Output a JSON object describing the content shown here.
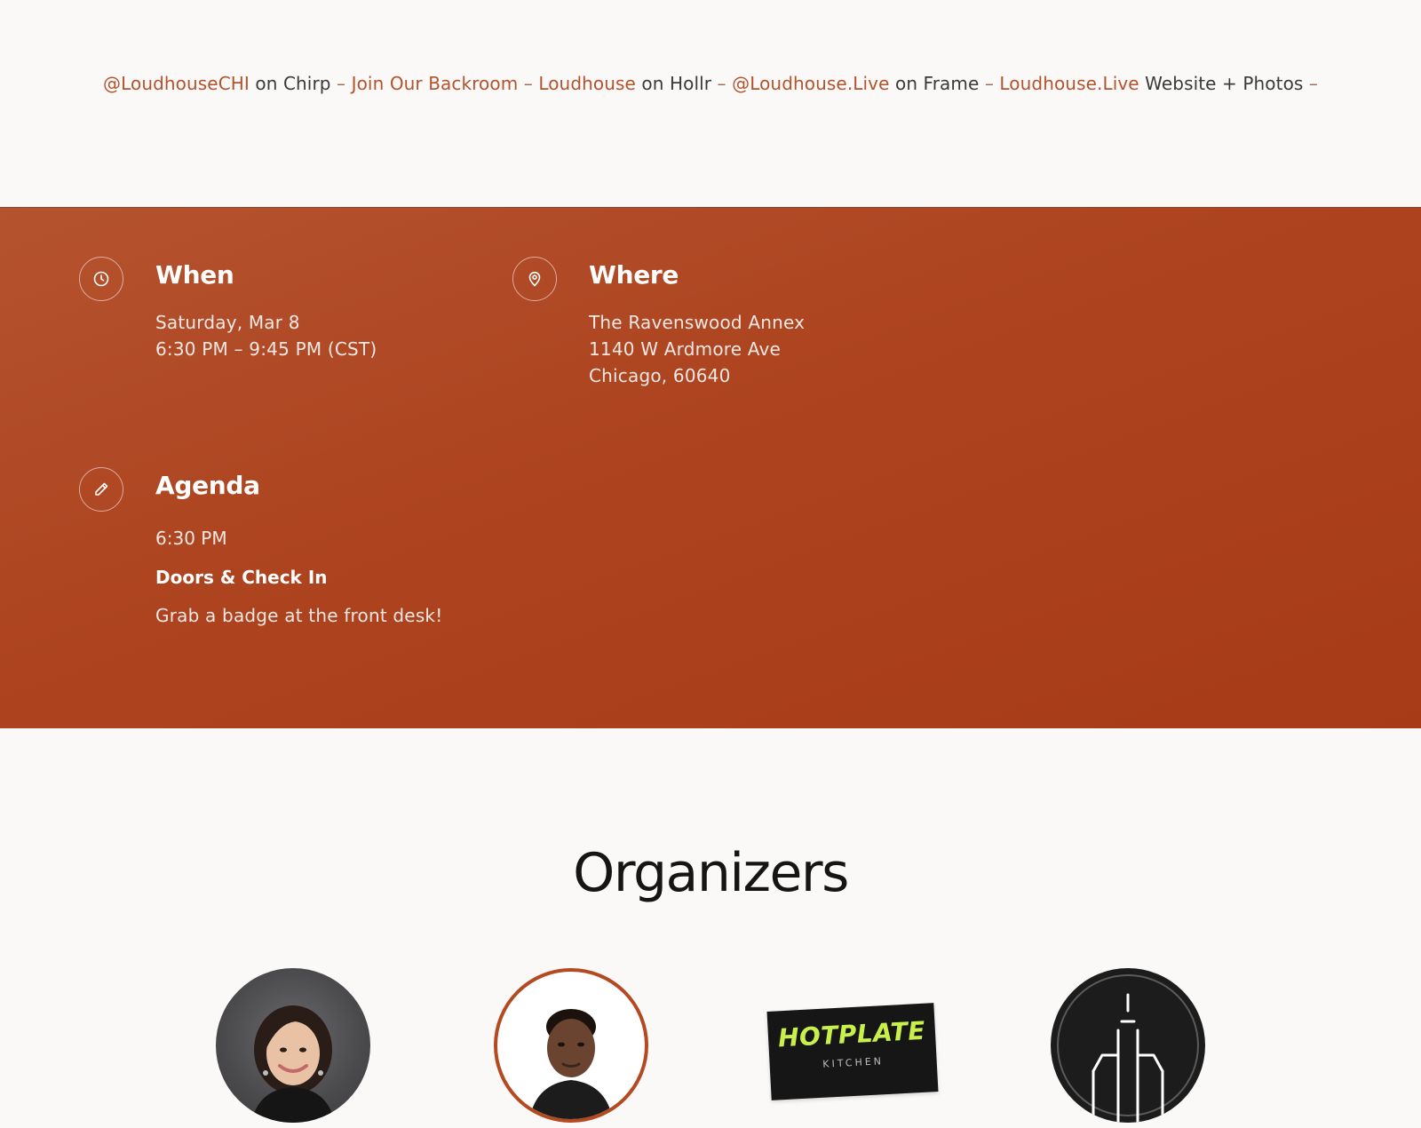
{
  "links": {
    "items": [
      {
        "link": "@LoudhouseCHI",
        "suffix": " on Chirp"
      },
      {
        "link": "Join Our Backroom",
        "suffix": ""
      },
      {
        "link": "Loudhouse",
        "suffix": " on Hollr"
      },
      {
        "link": "@Loudhouse.Live",
        "suffix": " on Frame"
      },
      {
        "link": "Loudhouse.Live",
        "suffix": " Website + Photos"
      }
    ],
    "separator": " – "
  },
  "details": {
    "when": {
      "title": "When",
      "date": "Saturday, Mar 8",
      "time": "6:30 PM – 9:45 PM (CST)",
      "icon": "clock-icon"
    },
    "where": {
      "title": "Where",
      "venue": "The Ravenswood Annex",
      "street": "1140 W Ardmore Ave",
      "city": "Chicago, 60640",
      "icon": "map-pin-icon"
    },
    "agenda": {
      "title": "Agenda",
      "icon": "pencil-icon",
      "items": [
        {
          "time": "6:30 PM",
          "title": "Doors & Check In",
          "description": "Grab a badge at the front desk!"
        }
      ]
    }
  },
  "organizers": {
    "heading": "Organizers",
    "items": [
      {
        "type": "photo",
        "name": ""
      },
      {
        "type": "photo",
        "name": ""
      },
      {
        "type": "logo",
        "logo_text": "HOTPLATE",
        "logo_subtext": "KITCHEN"
      },
      {
        "type": "logo",
        "name": ""
      }
    ]
  },
  "colors": {
    "accent": "#b2532e",
    "band": "#ad431f",
    "hotplate_green": "#c9ef4a"
  }
}
